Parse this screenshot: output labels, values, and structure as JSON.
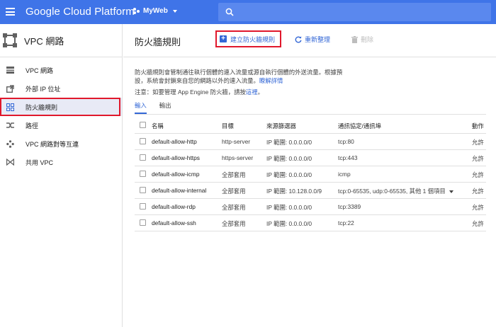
{
  "topbar": {
    "brand": "Google Cloud Platform",
    "project": "MyWeb",
    "colors": {
      "bar": "#3f74e8",
      "search": "#5a88ee"
    }
  },
  "sidebar": {
    "title": "VPC 網路",
    "items": [
      {
        "label": "VPC 網路",
        "icon": "vpc-network-icon"
      },
      {
        "label": "外部 IP 位址",
        "icon": "external-ip-icon"
      },
      {
        "label": "防火牆規則",
        "icon": "firewall-icon",
        "active": true
      },
      {
        "label": "路徑",
        "icon": "routes-icon"
      },
      {
        "label": "VPC 網路對等互連",
        "icon": "peering-icon"
      },
      {
        "label": "共用 VPC",
        "icon": "shared-vpc-icon"
      }
    ]
  },
  "header": {
    "title": "防火牆規則",
    "create": "建立防火牆規則",
    "refresh": "重新整理",
    "delete": "刪除"
  },
  "description": {
    "line1": "防火牆規則會管制通往執行個體的連入流量或源自執行個體的外送流量。根據預",
    "line2": "設，系統會封鎖來自您的網路以外的連入流量。",
    "learn_more": "瞭解詳情",
    "note_prefix": "注意：如要管理 App Engine 防火牆，請按",
    "note_link": "這裡",
    "note_suffix": "。"
  },
  "tabs": [
    "輸入",
    "輸出"
  ],
  "table": {
    "columns": [
      "名稱",
      "目標",
      "來源篩選器",
      "通訊協定/通訊埠",
      "動作"
    ],
    "rows": [
      {
        "name": "default-allow-http",
        "target": "http-server",
        "source": "IP 範圍: 0.0.0.0/0",
        "protocol": "tcp:80",
        "action": "允許"
      },
      {
        "name": "default-allow-https",
        "target": "https-server",
        "source": "IP 範圍: 0.0.0.0/0",
        "protocol": "tcp:443",
        "action": "允許"
      },
      {
        "name": "default-allow-icmp",
        "target": "全部套用",
        "source": "IP 範圍: 0.0.0.0/0",
        "protocol": "icmp",
        "action": "允許"
      },
      {
        "name": "default-allow-internal",
        "target": "全部套用",
        "source": "IP 範圍: 10.128.0.0/9",
        "protocol": "tcp:0-65535, udp:0-65535, 其他 1 個項目",
        "action": "允許"
      },
      {
        "name": "default-allow-rdp",
        "target": "全部套用",
        "source": "IP 範圍: 0.0.0.0/0",
        "protocol": "tcp:3389",
        "action": "允許"
      },
      {
        "name": "default-allow-ssh",
        "target": "全部套用",
        "source": "IP 範圍: 0.0.0.0/0",
        "protocol": "tcp:22",
        "action": "允許"
      }
    ]
  }
}
